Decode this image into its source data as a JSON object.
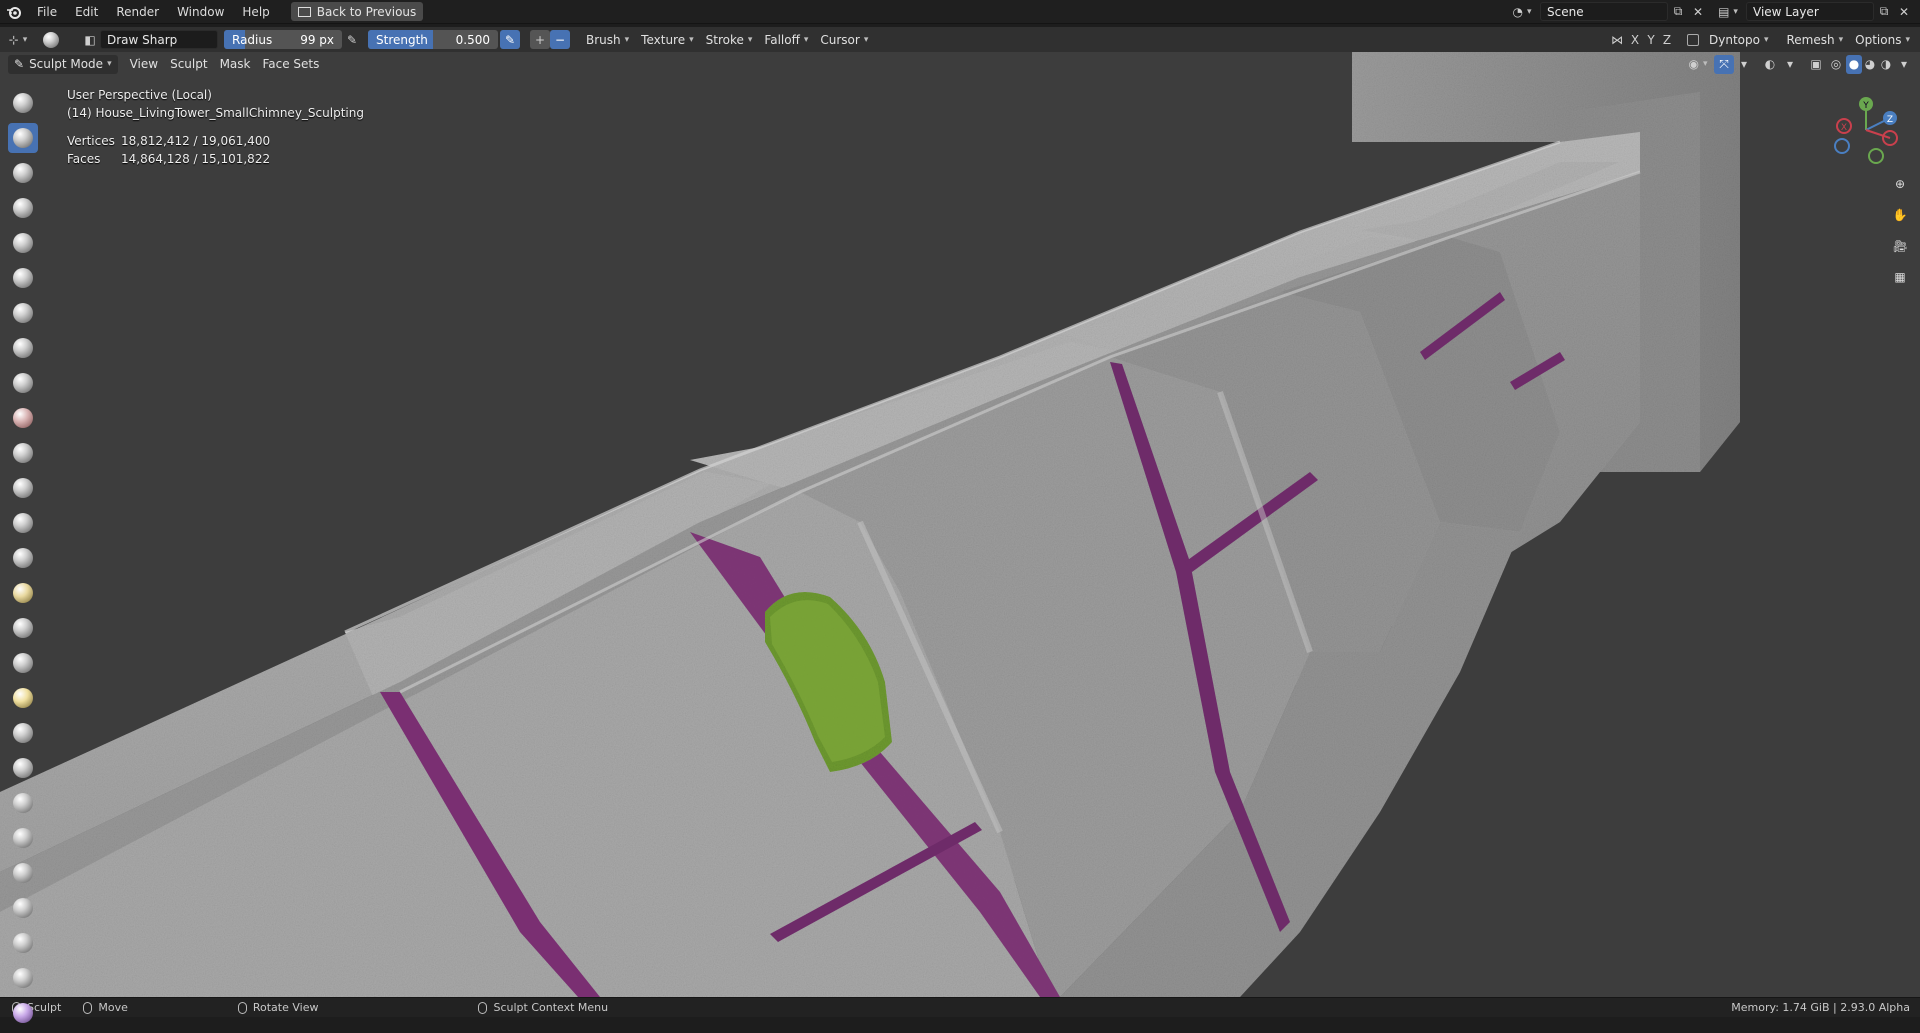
{
  "topbar": {
    "logo_icon": "blender-logo-icon",
    "menus": [
      "File",
      "Edit",
      "Render",
      "Window",
      "Help"
    ],
    "back_button": "Back to Previous",
    "scene_name": "Scene",
    "view_layer": "View Layer"
  },
  "tool_header": {
    "brush_name": "Draw Sharp",
    "radius_label": "Radius",
    "radius_value": "99 px",
    "radius_fraction": 0.18,
    "strength_label": "Strength",
    "strength_value": "0.500",
    "strength_fraction": 0.5,
    "plus": "+",
    "minus": "−",
    "menus": [
      "Brush",
      "Texture",
      "Stroke",
      "Falloff",
      "Cursor"
    ],
    "axes": [
      "X",
      "Y",
      "Z"
    ],
    "dyntopo": "Dyntopo",
    "remesh": "Remesh",
    "options": "Options"
  },
  "viewport_header": {
    "mode": "Sculpt Mode",
    "menus": [
      "View",
      "Sculpt",
      "Mask",
      "Face Sets"
    ]
  },
  "viewport_info": {
    "perspective": "User Perspective (Local)",
    "object": "(14) House_LivingTower_SmallChimney_Sculpting",
    "vertices_label": "Vertices",
    "vertices_value": "18,812,412 / 19,061,400",
    "faces_label": "Faces",
    "faces_value": "14,864,128 / 15,101,822"
  },
  "gizmo": {
    "x": "X",
    "y": "Y",
    "z": "Z"
  },
  "statusbar": {
    "items": [
      "Sculpt",
      "Move",
      "Rotate View",
      "Sculpt Context Menu"
    ],
    "memory": "Memory: 1.74 GiB | 2.93.0 Alpha"
  },
  "colors": {
    "accent": "#4772b3",
    "stone": "#9a9a9a",
    "grout": "#7a2f72",
    "moss": "#6f9a32"
  }
}
